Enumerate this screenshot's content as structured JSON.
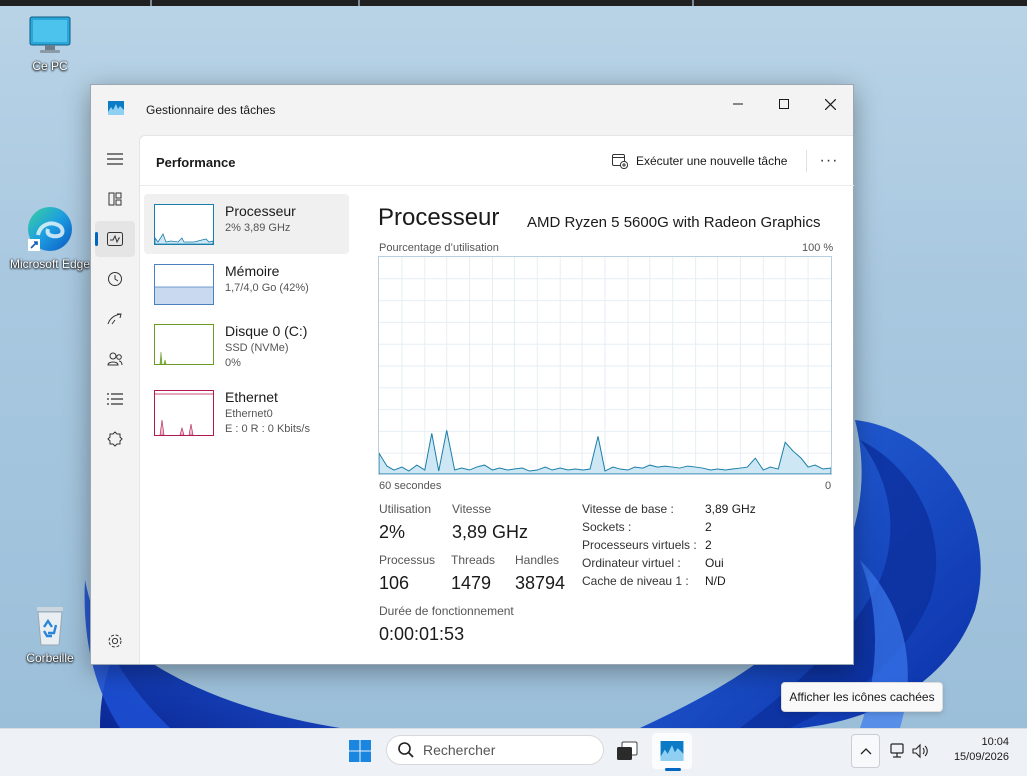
{
  "desktop": {
    "icons": [
      {
        "label": "Ce PC"
      },
      {
        "label": "Microsoft Edge"
      },
      {
        "label": "Corbeille"
      }
    ]
  },
  "window": {
    "title": "Gestionnaire des tâches",
    "header": {
      "page_title": "Performance",
      "run_new_task": "Exécuter une nouvelle tâche",
      "more": "···"
    },
    "nav_icons": [
      "menu-icon",
      "processes-icon",
      "performance-icon",
      "app-history-icon",
      "startup-apps-icon",
      "users-icon",
      "details-icon",
      "services-icon",
      "settings-icon"
    ],
    "resources": [
      {
        "name": "Processeur",
        "sub1": "2% 3,89 GHz",
        "sub2": "",
        "color": "#1b7ea8"
      },
      {
        "name": "Mémoire",
        "sub1": "1,7/4,0 Go (42%)",
        "sub2": "",
        "color": "#4a80c0"
      },
      {
        "name": "Disque 0 (C:)",
        "sub1": "SSD (NVMe)",
        "sub2": "0%",
        "color": "#6a9a2a"
      },
      {
        "name": "Ethernet",
        "sub1": "Ethernet0",
        "sub2": "E : 0 R : 0 Kbits/s",
        "color": "#b01a52"
      }
    ],
    "detail": {
      "title": "Processeur",
      "model": "AMD Ryzen 5 5600G with Radeon Graphics",
      "graph_label": "Pourcentage d’utilisation",
      "graph_max": "100 %",
      "graph_time": "60 secondes",
      "graph_min": "0",
      "stats": {
        "utilisation_label": "Utilisation",
        "utilisation": "2%",
        "speed_label": "Vitesse",
        "speed": "3,89 GHz",
        "processes_label": "Processus",
        "processes": "106",
        "threads_label": "Threads",
        "threads": "1479",
        "handles_label": "Handles",
        "handles": "38794",
        "uptime_label": "Durée de fonctionnement",
        "uptime": "0:00:01:53"
      },
      "specs": [
        {
          "k": "Vitesse de base :",
          "v": "3,89 GHz"
        },
        {
          "k": "Sockets :",
          "v": "2"
        },
        {
          "k": "Processeurs virtuels :",
          "v": "2"
        },
        {
          "k": "Ordinateur virtuel :",
          "v": "Oui"
        },
        {
          "k": "Cache de niveau 1 :",
          "v": "N/D"
        }
      ]
    },
    "accent_color": "#0067c0",
    "graph_line_color": "#1b7ea8",
    "graph_fill_color": "#cde8f4"
  },
  "taskbar": {
    "search_placeholder": "Rechercher",
    "time": "10:04",
    "date": "15/09/2026",
    "tooltip": "Afficher les icônes cachées"
  }
}
